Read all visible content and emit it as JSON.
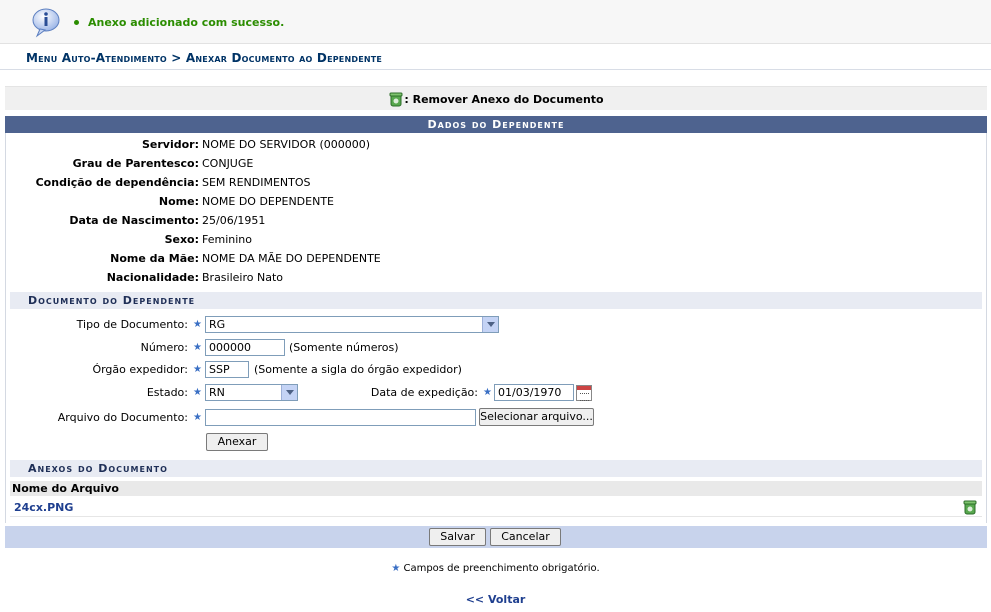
{
  "message": {
    "icon": "info-icon",
    "text": "Anexo adicionado com sucesso."
  },
  "breadcrumb": "Menu Auto-Atendimento > Anexar Documento ao Dependente",
  "remove_action": {
    "icon": "trash-icon",
    "label": ": Remover Anexo do Documento"
  },
  "dependent": {
    "title": "Dados do Dependente",
    "fields": [
      {
        "label": "Servidor:",
        "value": "NOME DO SERVIDOR (000000)"
      },
      {
        "label": "Grau de Parentesco:",
        "value": "CONJUGE"
      },
      {
        "label": "Condição de dependência:",
        "value": "SEM RENDIMENTOS"
      },
      {
        "label": "Nome:",
        "value": "NOME DO DEPENDENTE"
      },
      {
        "label": "Data de Nascimento:",
        "value": "25/06/1951"
      },
      {
        "label": "Sexo:",
        "value": "Feminino"
      },
      {
        "label": "Nome da Mãe:",
        "value": "NOME DA MÃE DO DEPENDENTE"
      },
      {
        "label": "Nacionalidade:",
        "value": "Brasileiro Nato"
      }
    ]
  },
  "document": {
    "title": "Documento do Dependente",
    "tipo_label": "Tipo de Documento:",
    "tipo_value": "RG",
    "numero_label": "Número:",
    "numero_value": "000000",
    "numero_hint": "(Somente números)",
    "orgao_label": "Órgão expedidor:",
    "orgao_value": "SSP",
    "orgao_hint": "(Somente a sigla do órgão expedidor)",
    "estado_label": "Estado:",
    "estado_value": "RN",
    "data_label": "Data de expedição:",
    "data_value": "01/03/1970",
    "arquivo_label": "Arquivo do Documento:",
    "arquivo_value": "",
    "select_file_button": "Selecionar arquivo...",
    "attach_button": "Anexar",
    "required_mark": "★"
  },
  "attachments": {
    "title": "Anexos do Documento",
    "column": "Nome do Arquivo",
    "items": [
      {
        "name": "24cx.PNG"
      }
    ]
  },
  "actions": {
    "save": "Salvar",
    "cancel": "Cancelar"
  },
  "required_note": "Campos de preenchimento obrigatório.",
  "back_link": "<< Voltar",
  "colors": {
    "success": "#2b8d00",
    "header": "#4e638f",
    "link": "#1f3f8f"
  }
}
